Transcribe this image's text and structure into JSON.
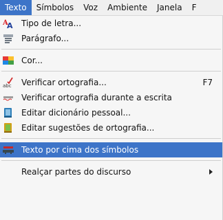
{
  "menubar": {
    "items": [
      {
        "label": "Texto"
      },
      {
        "label": "Símbolos"
      },
      {
        "label": "Voz"
      },
      {
        "label": "Ambiente"
      },
      {
        "label": "Janela"
      },
      {
        "label": "F"
      }
    ]
  },
  "menu": {
    "items": [
      {
        "label": "Tipo de letra...",
        "icon": "font-icon"
      },
      {
        "label": "Parágrafo...",
        "icon": "paragraph-icon"
      },
      {
        "label": "Cor...",
        "icon": "color-palette-icon"
      },
      {
        "label": "Verificar ortografia...",
        "icon": "spellcheck-icon",
        "shortcut": "F7"
      },
      {
        "label": "Verificar ortografia durante a escrita",
        "icon": "spellcheck-while-typing-icon"
      },
      {
        "label": "Editar dicionário pessoal...",
        "icon": "dictionary-book-icon"
      },
      {
        "label": "Editar sugestões de ortografia...",
        "icon": "suggestions-book-icon"
      },
      {
        "label": "Texto por cima dos símbolos",
        "icon": "text-above-symbols-icon"
      },
      {
        "label": "Realçar partes do discurso",
        "has_submenu": true
      }
    ]
  },
  "colors": {
    "accent": "#3d74c8",
    "menu_bg": "#f6f6f6"
  }
}
